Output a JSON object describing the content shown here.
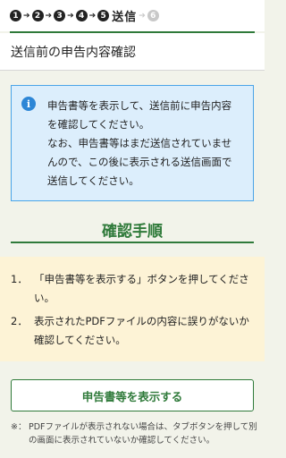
{
  "progress": {
    "steps": [
      "1",
      "2",
      "3",
      "4",
      "5"
    ],
    "current_label": "送信",
    "next_step": "6"
  },
  "header": {
    "title": "送信前の申告内容確認"
  },
  "info": {
    "icon": "info-icon",
    "lines": [
      "申告書等を表示して、送信前に申告内容",
      "を確認してください。",
      "なお、申告書等はまだ送信されていませ",
      "んので、この後に表示される送信画面で",
      "送信してください。"
    ]
  },
  "procedure": {
    "heading": "確認手順",
    "items": [
      {
        "num": "1．",
        "text": "「申告書等を表示する」ボタンを押してください。"
      },
      {
        "num": "2．",
        "text": "表示されたPDFファイルの内容に誤りがないか確認してください。"
      }
    ]
  },
  "actions": {
    "show_button_label": "申告書等を表示する"
  },
  "footnote": {
    "mark": "※：",
    "text": "PDFファイルが表示されない場合は、タブボタンを押して別の画面に表示されていないか確認してください。"
  },
  "colors": {
    "accent_green": "#2f7a3a",
    "info_blue": "#4aa4e8",
    "info_bg": "#dceefc",
    "steps_bg": "#fdf3d6"
  }
}
